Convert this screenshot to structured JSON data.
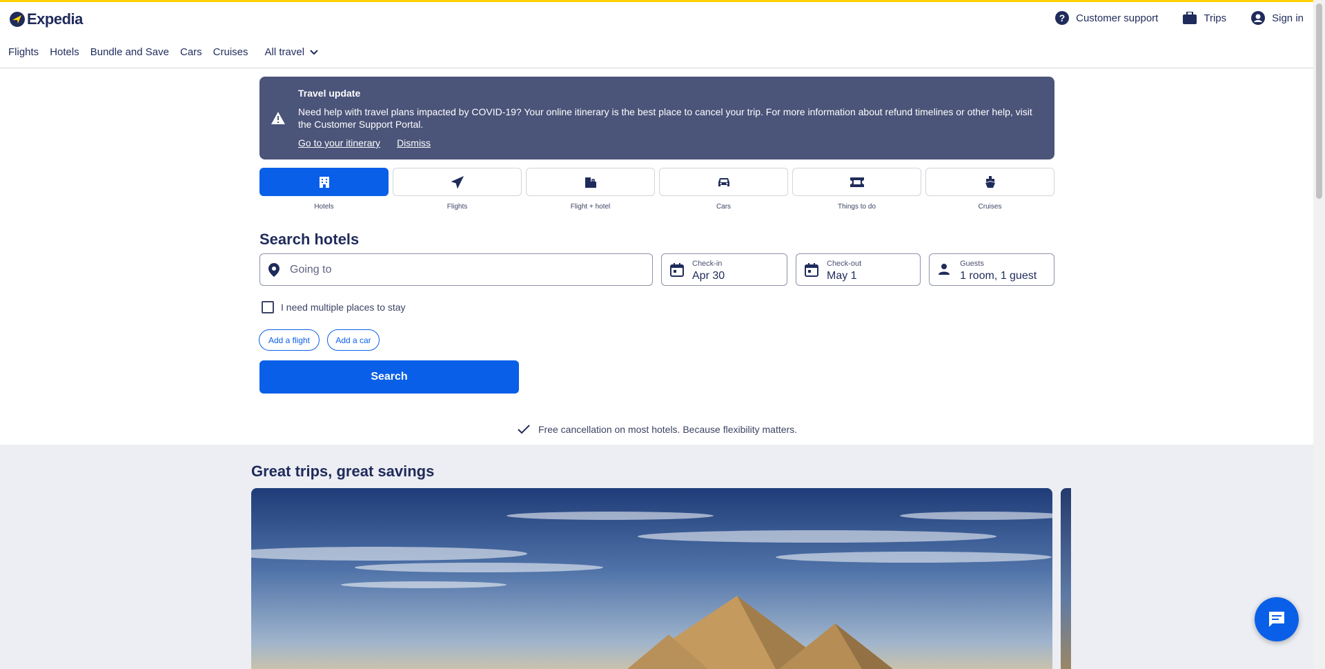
{
  "brand": {
    "name": "Expedia",
    "accent": "#ffd100",
    "primary": "#0a5fe8",
    "navy": "#1f2b5b",
    "banner": "#4b5479"
  },
  "header": {
    "utility": [
      {
        "label": "Customer support",
        "icon": "help-circle-icon"
      },
      {
        "label": "Trips",
        "icon": "briefcase-icon"
      },
      {
        "label": "Sign in",
        "icon": "account-icon"
      }
    ],
    "nav": [
      "Flights",
      "Hotels",
      "Bundle and Save",
      "Cars",
      "Cruises"
    ],
    "all_travel": "All travel"
  },
  "alert": {
    "title": "Travel update",
    "body": "Need help with travel plans impacted by COVID-19? Your online itinerary is the best place to cancel your trip. For more information about refund timelines or other help, visit the Customer Support Portal.",
    "link_itinerary": "Go to your itinerary",
    "link_dismiss": "Dismiss"
  },
  "tabs": [
    {
      "label": "Hotels",
      "icon": "hotel-icon",
      "active": true
    },
    {
      "label": "Flights",
      "icon": "plane-icon",
      "active": false
    },
    {
      "label": "Flight + hotel",
      "icon": "luggage-icon",
      "active": false
    },
    {
      "label": "Cars",
      "icon": "car-icon",
      "active": false
    },
    {
      "label": "Things to do",
      "icon": "ticket-icon",
      "active": false
    },
    {
      "label": "Cruises",
      "icon": "cruise-icon",
      "active": false
    }
  ],
  "search": {
    "title": "Search hotels",
    "going_to_placeholder": "Going to",
    "checkin_label": "Check-in",
    "checkin_value": "Apr 30",
    "checkout_label": "Check-out",
    "checkout_value": "May 1",
    "guests_label": "Guests",
    "guests_value": "1 room, 1 guest",
    "multiple_places": "I need multiple places to stay",
    "add_flight": "Add a flight",
    "add_car": "Add a car",
    "button": "Search"
  },
  "free_cancellation": "Free cancellation on most hotels. Because flexibility matters.",
  "promo": {
    "title": "Great trips, great savings"
  }
}
